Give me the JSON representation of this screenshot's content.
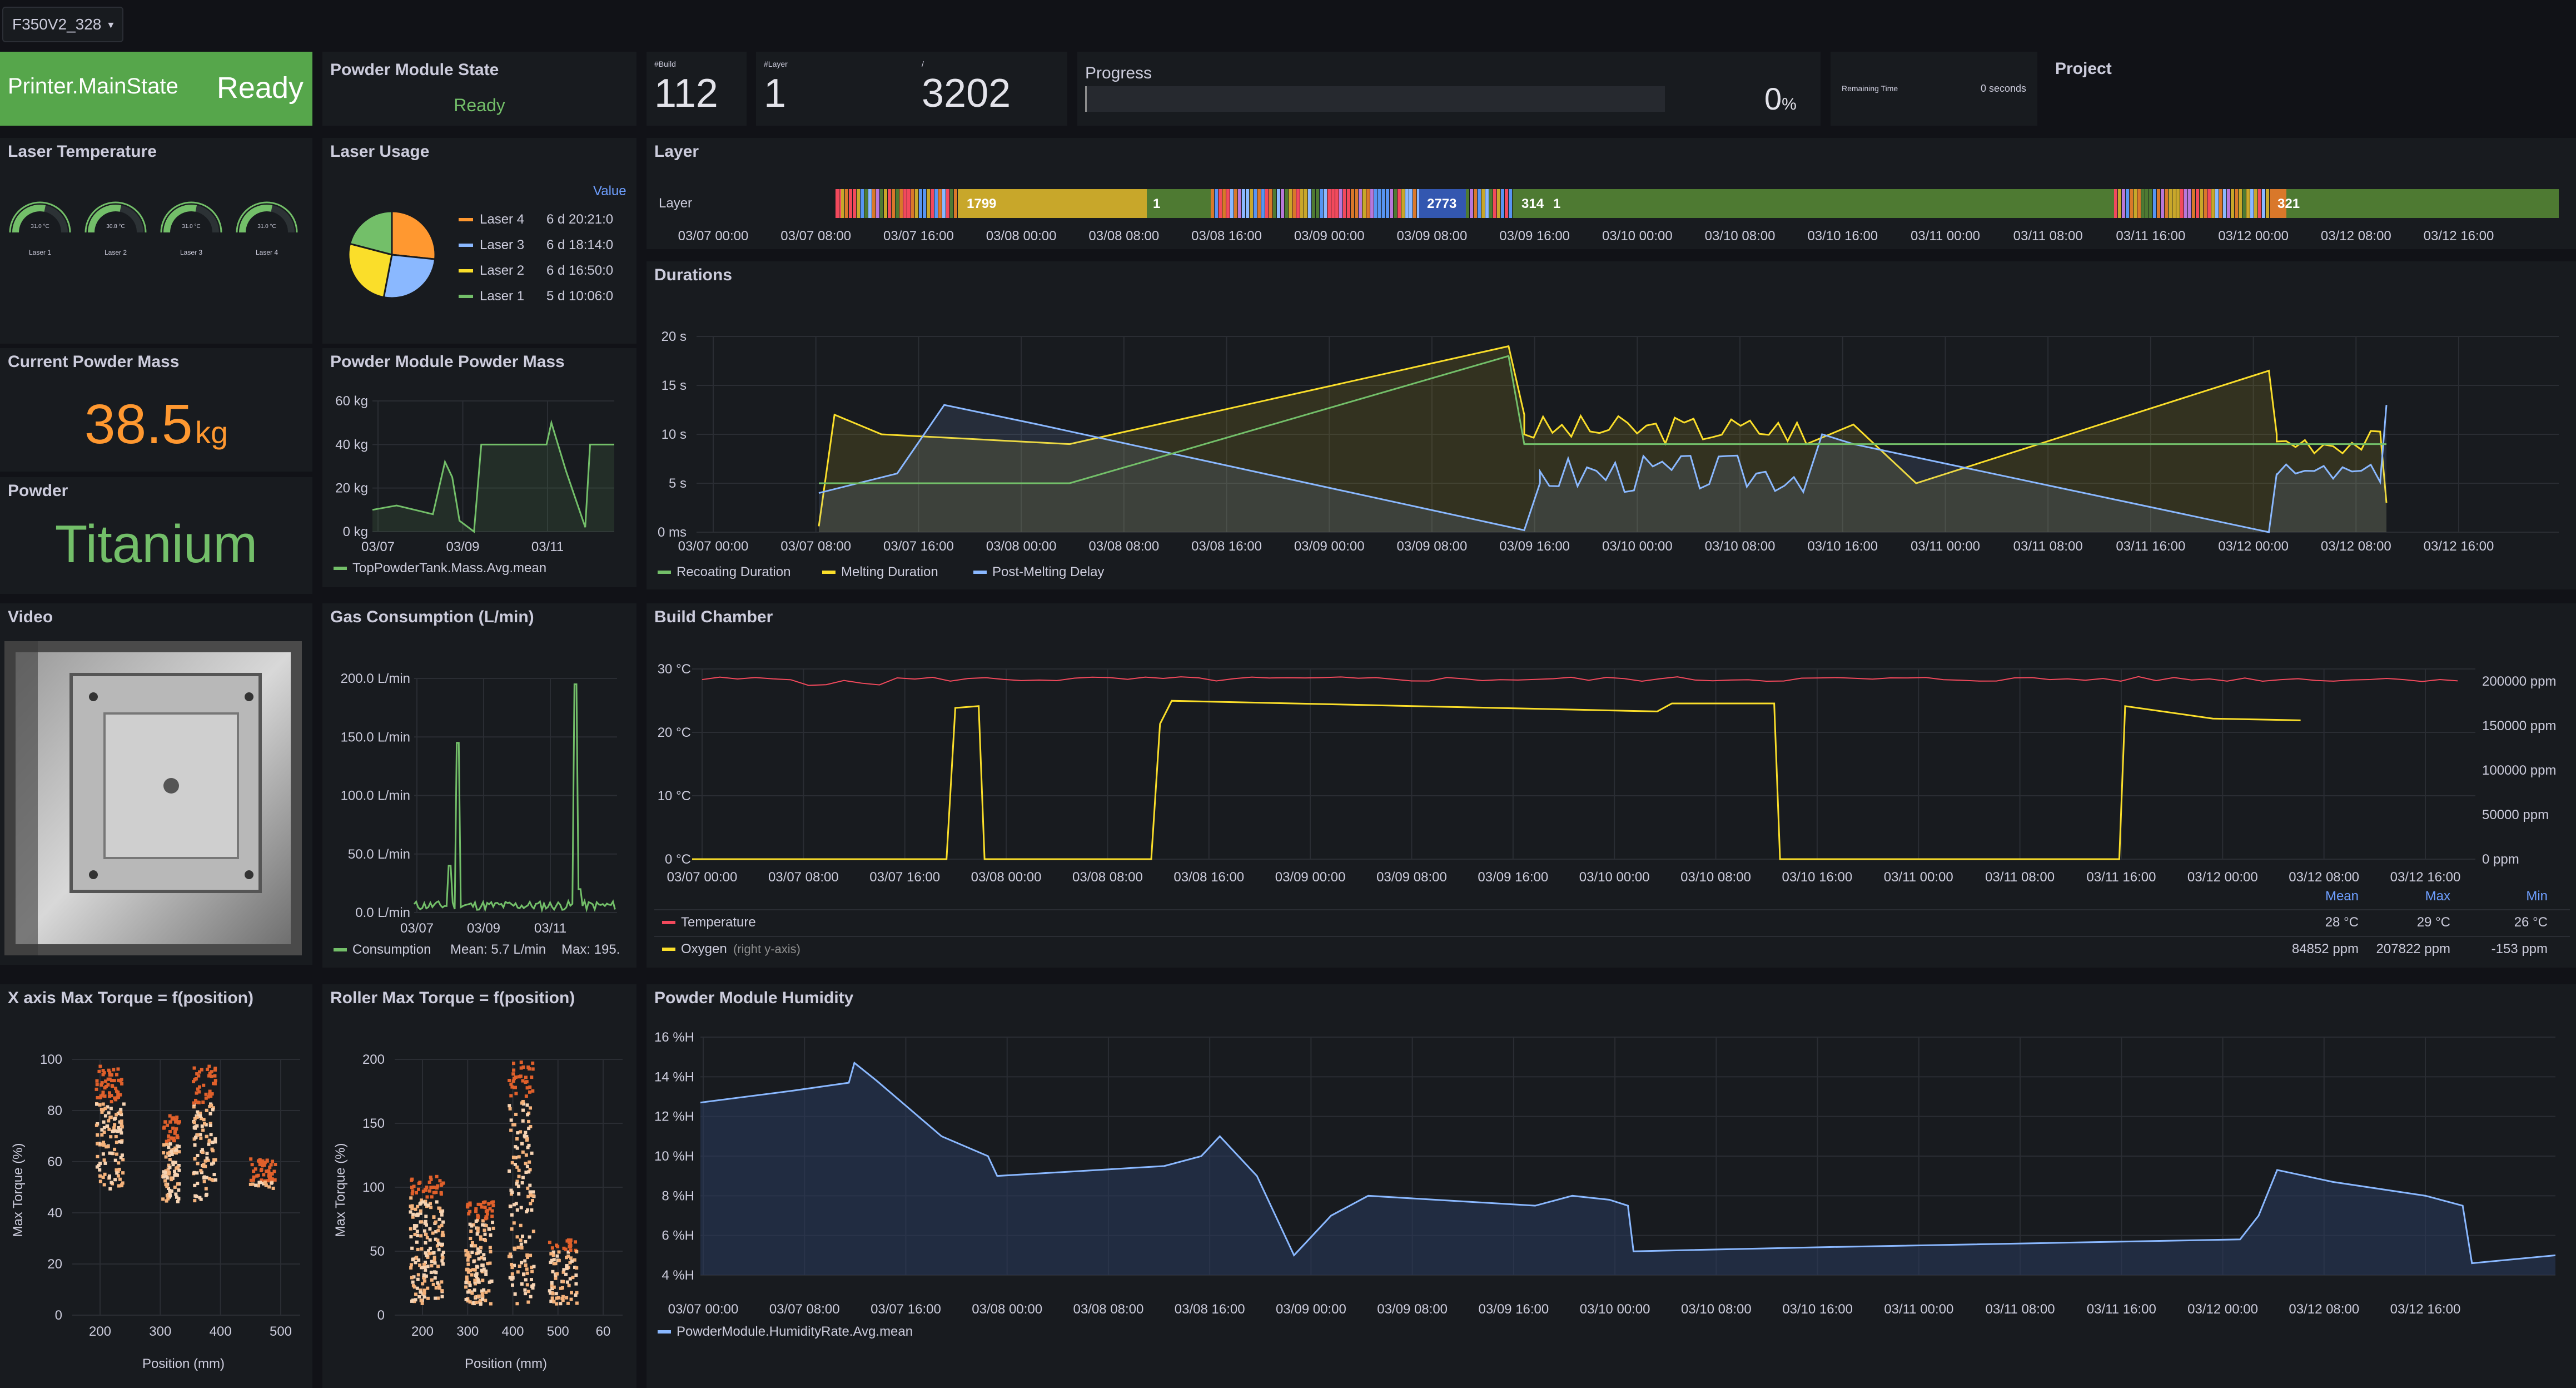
{
  "topbar": {
    "machine": "F350V2_328"
  },
  "stats": {
    "main_state": {
      "label": "Printer.MainState",
      "value": "Ready"
    },
    "powder_state": {
      "title": "Powder Module State",
      "value": "Ready"
    },
    "build": {
      "caption": "#Build",
      "value": "112"
    },
    "layer": {
      "caption": "#Layer",
      "value": "1",
      "sep": "/",
      "total": "3202"
    },
    "progress": {
      "title": "Progress",
      "value": "0",
      "unit": "%",
      "fraction": 0
    },
    "remaining": {
      "label": "Remaining Time",
      "value": "0 seconds"
    },
    "project": {
      "title": "Project"
    }
  },
  "colors": {
    "green": "#73bf69",
    "yellow": "#fade2a",
    "blue": "#8ab8ff",
    "red": "#f2495c",
    "orange": "#ff9830",
    "fill_blue": "#2a3a5c"
  },
  "laser_temp": {
    "title": "Laser Temperature",
    "gauges": [
      {
        "label": "Laser 1",
        "value": "31.0 °C"
      },
      {
        "label": "Laser 2",
        "value": "30.8 °C"
      },
      {
        "label": "Laser 3",
        "value": "31.0 °C"
      },
      {
        "label": "Laser 4",
        "value": "31.0 °C"
      }
    ]
  },
  "laser_usage": {
    "title": "Laser Usage",
    "value_header": "Value",
    "items": [
      {
        "name": "Laser 4",
        "value": "6 d 20:21:0",
        "color": "#ff9830"
      },
      {
        "name": "Laser 3",
        "value": "6 d 18:14:0",
        "color": "#8ab8ff"
      },
      {
        "name": "Laser 2",
        "value": "6 d 16:50:0",
        "color": "#fade2a"
      },
      {
        "name": "Laser 1",
        "value": "5 d 10:06:0",
        "color": "#73bf69"
      }
    ],
    "chart_data": {
      "type": "pie",
      "labels": [
        "Laser 4",
        "Laser 3",
        "Laser 2",
        "Laser 1"
      ],
      "values": [
        25.6,
        25.3,
        25.0,
        20.1
      ]
    }
  },
  "layer_panel": {
    "title": "Layer",
    "row_label": "Layer",
    "labels": [
      "1799",
      "1",
      "2773",
      "314",
      "1",
      "321"
    ],
    "ticks": [
      "03/07 00:00",
      "03/07 08:00",
      "03/07 16:00",
      "03/08 00:00",
      "03/08 08:00",
      "03/08 16:00",
      "03/09 00:00",
      "03/09 08:00",
      "03/09 16:00",
      "03/10 00:00",
      "03/10 08:00",
      "03/10 16:00",
      "03/11 00:00",
      "03/11 08:00",
      "03/11 16:00",
      "03/12 00:00",
      "03/12 08:00",
      "03/12 16:00"
    ]
  },
  "durations": {
    "title": "Durations",
    "chart_data": {
      "type": "area",
      "yticks": [
        "20 s",
        "15 s",
        "10 s",
        "5 s",
        "0 ms"
      ],
      "ylim": [
        0,
        20
      ],
      "xticks": [
        "03/07 00:00",
        "03/07 08:00",
        "03/07 16:00",
        "03/08 00:00",
        "03/08 08:00",
        "03/08 16:00",
        "03/09 00:00",
        "03/09 08:00",
        "03/09 16:00",
        "03/10 00:00",
        "03/10 08:00",
        "03/10 16:00",
        "03/11 00:00",
        "03/11 08:00",
        "03/11 16:00",
        "03/12 00:00",
        "03/12 08:00",
        "03/12 16:00"
      ],
      "series": [
        {
          "name": "Recoating Duration",
          "color": "#73bf69"
        },
        {
          "name": "Melting Duration",
          "color": "#fade2a"
        },
        {
          "name": "Post-Melting Delay",
          "color": "#8ab8ff"
        }
      ]
    }
  },
  "powder_mass": {
    "title": "Current Powder Mass",
    "value": "38.5",
    "unit": "kg"
  },
  "pm_mass": {
    "title": "Powder Module Powder Mass",
    "chart_data": {
      "type": "line",
      "yticks": [
        "60 kg",
        "40 kg",
        "20 kg",
        "0 kg"
      ],
      "ylim": [
        0,
        60
      ],
      "xticks": [
        "03/07",
        "03/09",
        "03/11"
      ],
      "series": [
        {
          "name": "TopPowderTank.Mass.Avg.mean",
          "color": "#73bf69"
        }
      ]
    }
  },
  "powder": {
    "title": "Powder",
    "value": "Titanium"
  },
  "video": {
    "title": "Video"
  },
  "gas": {
    "title": "Gas Consumption (L/min)",
    "chart_data": {
      "type": "line",
      "yticks": [
        "200.0 L/min",
        "150.0 L/min",
        "100.0 L/min",
        "50.0 L/min",
        "0.0 L/min"
      ],
      "ylim": [
        0,
        200
      ],
      "xticks": [
        "03/07",
        "03/09",
        "03/11"
      ],
      "series": [
        {
          "name": "Consumption",
          "color": "#73bf69"
        }
      ]
    },
    "legend_mean": "Mean: 5.7 L/min",
    "legend_max": "Max: 195."
  },
  "build_chamber": {
    "title": "Build Chamber",
    "chart_data": {
      "type": "line",
      "yticks_left": [
        "30 °C",
        "20 °C",
        "10 °C",
        "0 °C"
      ],
      "ylim_left": [
        0,
        30
      ],
      "yticks_right": [
        "200000 ppm",
        "150000 ppm",
        "100000 ppm",
        "50000 ppm",
        "0 ppm"
      ],
      "ylim_right": [
        0,
        200000
      ],
      "xticks": [
        "03/07 00:00",
        "03/07 08:00",
        "03/07 16:00",
        "03/08 00:00",
        "03/08 08:00",
        "03/08 16:00",
        "03/09 00:00",
        "03/09 08:00",
        "03/09 16:00",
        "03/10 00:00",
        "03/10 08:00",
        "03/10 16:00",
        "03/11 00:00",
        "03/11 08:00",
        "03/11 16:00",
        "03/12 00:00",
        "03/12 08:00",
        "03/12 16:00"
      ],
      "series": [
        {
          "name": "Temperature",
          "color": "#f2495c"
        },
        {
          "name": "Oxygen",
          "color": "#fade2a"
        }
      ]
    },
    "headers": [
      "Mean",
      "Max",
      "Min"
    ],
    "rows": [
      {
        "name": "Temperature",
        "note": "",
        "mean": "28 °C",
        "max": "29 °C",
        "min": "26 °C"
      },
      {
        "name": "Oxygen",
        "note": "(right y-axis)",
        "mean": "84852 ppm",
        "max": "207822 ppm",
        "min": "-153 ppm"
      }
    ]
  },
  "x_torque": {
    "title": "X axis Max Torque = f(position)",
    "chart_data": {
      "type": "scatter",
      "yticks": [
        "100",
        "80",
        "60",
        "40",
        "20",
        "0"
      ],
      "ylim": [
        0,
        100
      ],
      "xticks": [
        "200",
        "300",
        "400",
        "500"
      ],
      "xlabel": "Position (mm)",
      "ylabel": "Max Torque (%)"
    }
  },
  "roller_torque": {
    "title": "Roller Max Torque = f(position)",
    "chart_data": {
      "type": "scatter",
      "yticks": [
        "200",
        "150",
        "100",
        "50",
        "0"
      ],
      "ylim": [
        0,
        200
      ],
      "xticks": [
        "200",
        "300",
        "400",
        "500",
        "60"
      ],
      "xlabel": "Position (mm)",
      "ylabel": "Max Torque (%)"
    }
  },
  "humidity": {
    "title": "Powder Module Humidity",
    "chart_data": {
      "type": "area",
      "yticks": [
        "16 %H",
        "14 %H",
        "12 %H",
        "10 %H",
        "8 %H",
        "6 %H",
        "4 %H"
      ],
      "ylim": [
        3,
        16
      ],
      "xticks": [
        "03/07 00:00",
        "03/07 08:00",
        "03/07 16:00",
        "03/08 00:00",
        "03/08 08:00",
        "03/08 16:00",
        "03/09 00:00",
        "03/09 08:00",
        "03/09 16:00",
        "03/10 00:00",
        "03/10 08:00",
        "03/10 16:00",
        "03/11 00:00",
        "03/11 08:00",
        "03/11 16:00",
        "03/12 00:00",
        "03/12 08:00",
        "03/12 16:00"
      ],
      "series": [
        {
          "name": "PowderModule.HumidityRate.Avg.mean",
          "color": "#8ab8ff"
        }
      ]
    }
  }
}
